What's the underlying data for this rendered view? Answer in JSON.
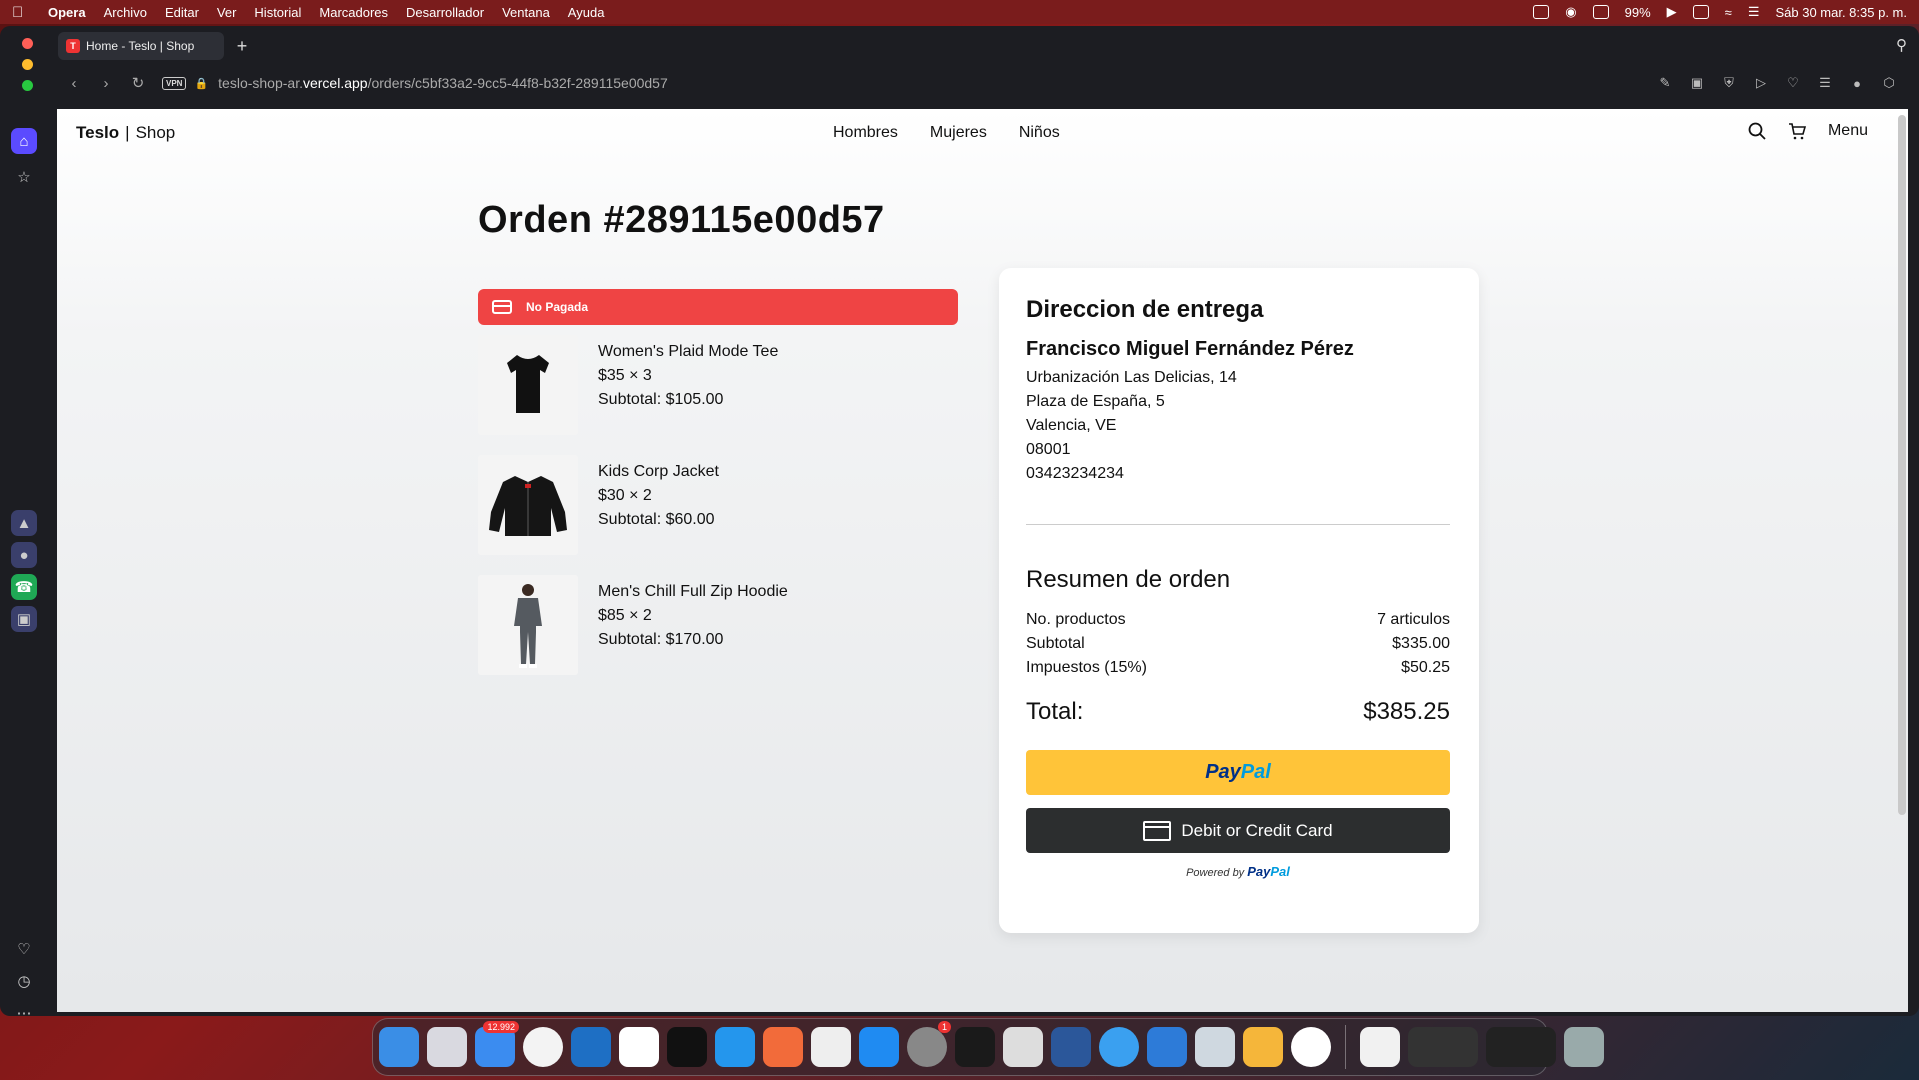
{
  "menubar": {
    "app": "Opera",
    "items": [
      "Archivo",
      "Editar",
      "Ver",
      "Historial",
      "Marcadores",
      "Desarrollador",
      "Ventana",
      "Ayuda"
    ],
    "battery": "99%",
    "datetime": "Sáb 30 mar.  8:35 p. m."
  },
  "browser": {
    "tab_title": "Home - Teslo | Shop",
    "tab_favicon": "T",
    "url_prefix": "teslo-shop-ar.",
    "url_domain": "vercel.app",
    "url_path": "/orders/c5bf33a2-9cc5-44f8-b32f-289115e00d57",
    "vpn": "VPN"
  },
  "site": {
    "brand_main": "Teslo",
    "brand_sub": "Shop",
    "nav": [
      "Hombres",
      "Mujeres",
      "Niños"
    ],
    "menu_label": "Menu"
  },
  "order": {
    "title": "Orden #289115e00d57",
    "status": "No Pagada",
    "items": [
      {
        "name": "Women's Plaid Mode Tee",
        "qty": "$35 × 3",
        "subtotal": "Subtotal: $105.00"
      },
      {
        "name": "Kids Corp Jacket",
        "qty": "$30 × 2",
        "subtotal": "Subtotal: $60.00"
      },
      {
        "name": "Men's Chill Full Zip Hoodie",
        "qty": "$85 × 2",
        "subtotal": "Subtotal: $170.00"
      }
    ]
  },
  "delivery": {
    "title": "Direccion de entrega",
    "name": "Francisco Miguel Fernández Pérez",
    "lines": [
      "Urbanización Las Delicias, 14",
      "Plaza de España, 5",
      "Valencia, VE",
      "08001",
      "03423234234"
    ]
  },
  "summary": {
    "title": "Resumen de orden",
    "rows": [
      {
        "label": "No. productos",
        "value": "7 articulos"
      },
      {
        "label": "Subtotal",
        "value": "$335.00"
      },
      {
        "label": "Impuestos (15%)",
        "value": "$50.25"
      }
    ],
    "total_label": "Total:",
    "total_value": "$385.25"
  },
  "payment": {
    "paypal_a": "Pay",
    "paypal_b": "Pal",
    "card_label": "Debit or Credit Card",
    "powered_by": "Powered by",
    "powered_brand_a": "Pay",
    "powered_brand_b": "Pal"
  },
  "dock": {
    "mail_badge": "12.992",
    "settings_badge": "1"
  }
}
